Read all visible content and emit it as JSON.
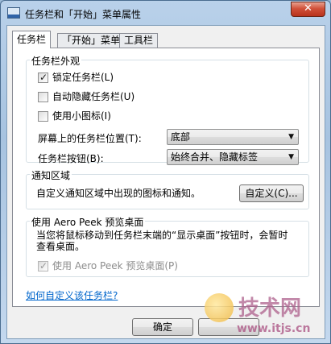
{
  "window": {
    "title": "任务栏和「开始」菜单属性",
    "close_label": "✕"
  },
  "tabs": [
    {
      "label": "任务栏",
      "active": true
    },
    {
      "label": "「开始」菜单",
      "active": false
    },
    {
      "label": "工具栏",
      "active": false
    }
  ],
  "appearance": {
    "title": "任务栏外观",
    "lock": {
      "label": "锁定任务栏(L)",
      "checked": true
    },
    "autohide": {
      "label": "自动隐藏任务栏(U)",
      "checked": false
    },
    "small_icons": {
      "label": "使用小图标(I)",
      "checked": false
    },
    "location_label": "屏幕上的任务栏位置(T):",
    "location_value": "底部",
    "buttons_label": "任务栏按钮(B):",
    "buttons_value": "始终合并、隐藏标签"
  },
  "notification": {
    "title": "通知区域",
    "description": "自定义通知区域中出现的图标和通知。",
    "customize_button": "自定义(C)..."
  },
  "peek": {
    "title": "使用 Aero Peek 预览桌面",
    "description_line1": "当您将鼠标移动到任务栏末端的“显示桌面”按钮时，会暂时",
    "description_line2": "查看桌面。",
    "checkbox": {
      "label": "使用 Aero Peek 预览桌面(P)",
      "checked": true,
      "disabled": true
    }
  },
  "help_link": "如何自定义该任务栏?",
  "footer": {
    "ok_label": "确定"
  },
  "watermark": {
    "title": "技术网",
    "url": "www.itjs.cn"
  }
}
